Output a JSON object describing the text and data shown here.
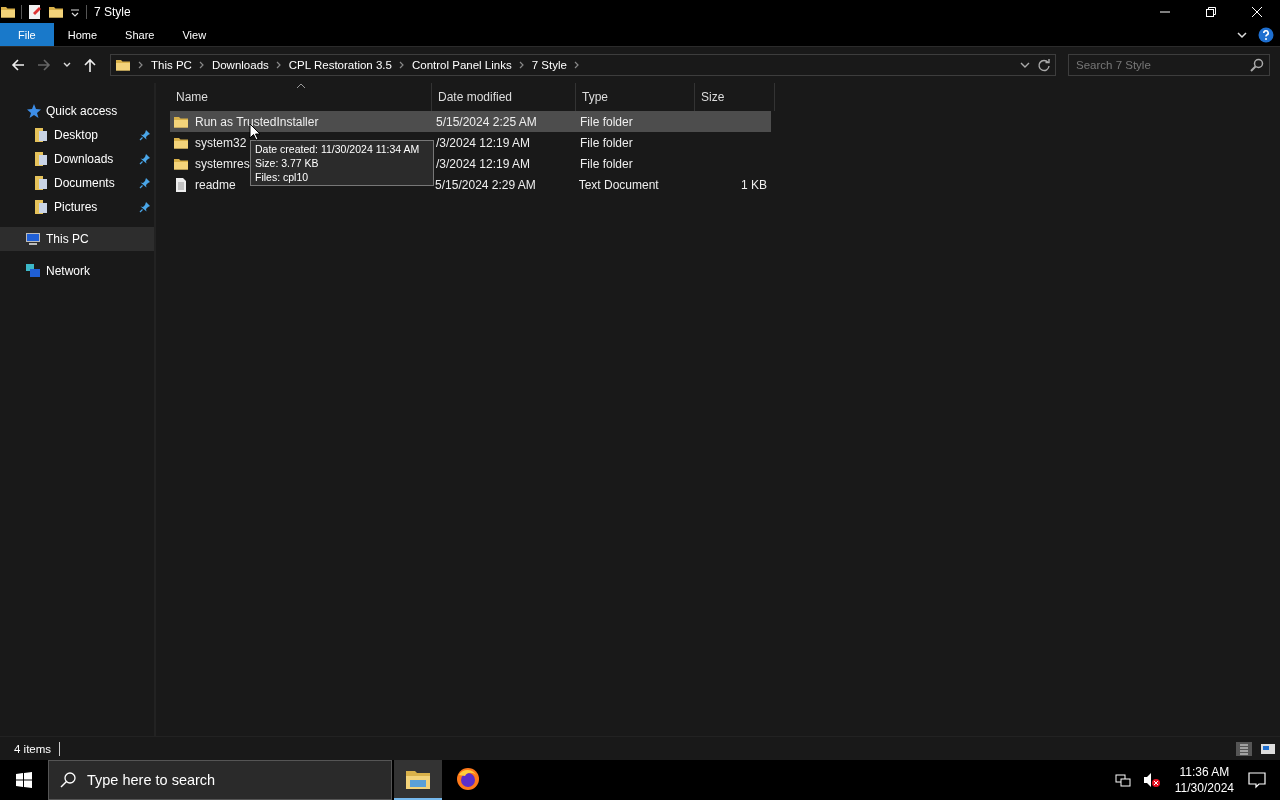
{
  "window": {
    "title": "7 Style"
  },
  "ribbon_tabs": [
    {
      "label": "File",
      "selected": true
    },
    {
      "label": "Home",
      "selected": false
    },
    {
      "label": "Share",
      "selected": false
    },
    {
      "label": "View",
      "selected": false
    }
  ],
  "navigation": {
    "back_disabled": false,
    "forward_disabled": true
  },
  "breadcrumbs": [
    "This PC",
    "Downloads",
    "CPL Restoration 3.5",
    "Control Panel Links",
    "7 Style"
  ],
  "search": {
    "placeholder": "Search 7 Style"
  },
  "sidebar": {
    "items": [
      {
        "label": "Quick access",
        "kind": "star",
        "selected": false,
        "children": [
          {
            "label": "Desktop",
            "kind": "folder",
            "pinned": true,
            "selected": false
          },
          {
            "label": "Downloads",
            "kind": "folder",
            "pinned": true,
            "selected": false
          },
          {
            "label": "Documents",
            "kind": "folder",
            "pinned": true,
            "selected": false
          },
          {
            "label": "Pictures",
            "kind": "folder",
            "pinned": true,
            "selected": false
          }
        ]
      },
      {
        "label": "This PC",
        "kind": "pc",
        "selected": true
      },
      {
        "label": "Network",
        "kind": "network",
        "selected": false
      }
    ]
  },
  "table": {
    "columns": [
      "Name",
      "Date modified",
      "Type",
      "Size"
    ],
    "rows": [
      {
        "kind": "folder",
        "name": "Run as TrustedInstaller",
        "date": "5/15/2024 2:25 AM",
        "type": "File folder",
        "size": "",
        "selected": true
      },
      {
        "kind": "folder",
        "name": "system32",
        "date": "/3/2024 12:19 AM",
        "type": "File folder",
        "size": "",
        "selected": false
      },
      {
        "kind": "folder",
        "name": "systemres",
        "date": "/3/2024 12:19 AM",
        "type": "File folder",
        "size": "",
        "selected": false
      },
      {
        "kind": "file",
        "name": "readme",
        "date": "5/15/2024 2:29 AM",
        "type": "Text Document",
        "size": "1 KB",
        "selected": false
      }
    ]
  },
  "tooltip": [
    "Date created: 11/30/2024 11:34 AM",
    "Size: 3.77 KB",
    "Files: cpl10"
  ],
  "status_bar": {
    "items": "4 items"
  },
  "taskbar": {
    "search_placeholder": "Type here to search",
    "apps": [
      {
        "kind": "explorer",
        "selected": true
      },
      {
        "kind": "browser",
        "selected": false
      }
    ],
    "time": "11:36 AM",
    "date": "11/30/2024"
  }
}
